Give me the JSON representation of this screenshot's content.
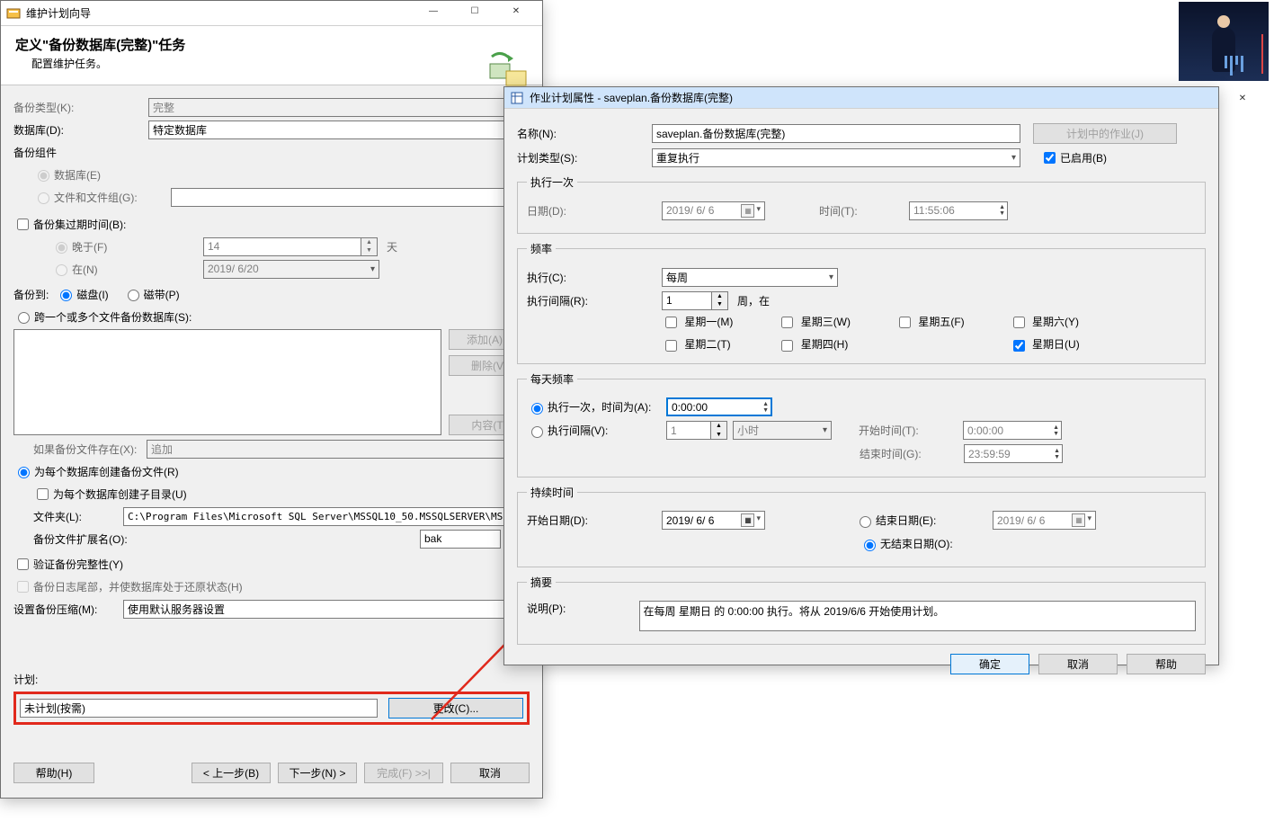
{
  "wizard": {
    "title": "维护计划向导",
    "header_title": "定义\"备份数据库(完整)\"任务",
    "header_sub": "配置维护任务。",
    "backup_type_label": "备份类型(K):",
    "backup_type_value": "完整",
    "database_label": "数据库(D):",
    "database_value": "特定数据库",
    "components_label": "备份组件",
    "comp_database": "数据库(E)",
    "comp_files": "文件和文件组(G):",
    "set_expire_label": "备份集过期时间(B):",
    "expire_after_label": "晚于(F)",
    "expire_after_value": "14",
    "expire_after_unit": "天",
    "expire_on_label": "在(N)",
    "expire_on_value": "2019/ 6/20",
    "backup_to_label": "备份到:",
    "to_disk": "磁盘(I)",
    "to_tape": "磁带(P)",
    "across_files": "跨一个或多个文件备份数据库(S):",
    "add_btn": "添加(A)...",
    "remove_btn": "删除(V)",
    "contents_btn": "内容(T)",
    "if_exists_label": "如果备份文件存在(X):",
    "if_exists_value": "追加",
    "per_db_label": "为每个数据库创建备份文件(R)",
    "per_db_subdir": "为每个数据库创建子目录(U)",
    "folder_label": "文件夹(L):",
    "folder_value": "C:\\Program Files\\Microsoft SQL Server\\MSSQL10_50.MSSQLSERVER\\MSSQL\\Bac.",
    "ext_label": "备份文件扩展名(O):",
    "ext_value": "bak",
    "verify_label": "验证备份完整性(Y)",
    "tail_log_label": "备份日志尾部，并使数据库处于还原状态(H)",
    "compression_label": "设置备份压缩(M):",
    "compression_value": "使用默认服务器设置",
    "schedule_section": "计划:",
    "schedule_value": "未计划(按需)",
    "change_btn": "更改(C)...",
    "help_btn": "帮助(H)",
    "back_btn": "< 上一步(B)",
    "next_btn": "下一步(N) >",
    "finish_btn": "完成(F) >>|",
    "cancel_btn": "取消"
  },
  "sched": {
    "title": "作业计划属性 - saveplan.备份数据库(完整)",
    "name_label": "名称(N):",
    "name_value": "saveplan.备份数据库(完整)",
    "jobs_btn": "计划中的作业(J)",
    "type_label": "计划类型(S):",
    "type_value": "重复执行",
    "enabled_label": "已启用(B)",
    "once_group": "执行一次",
    "once_date_label": "日期(D):",
    "once_date_value": "2019/ 6/ 6",
    "once_time_label": "时间(T):",
    "once_time_value": "11:55:06",
    "freq_group": "频率",
    "freq_exec_label": "执行(C):",
    "freq_exec_value": "每周",
    "freq_int_label": "执行间隔(R):",
    "freq_int_value": "1",
    "freq_int_unit": "周，在",
    "wk_mon": "星期一(M)",
    "wk_tue": "星期二(T)",
    "wk_wed": "星期三(W)",
    "wk_thu": "星期四(H)",
    "wk_fri": "星期五(F)",
    "wk_sat": "星期六(Y)",
    "wk_sun": "星期日(U)",
    "daily_group": "每天频率",
    "daily_once_label": "执行一次，时间为(A):",
    "daily_once_value": "0:00:00",
    "daily_int_label": "执行间隔(V):",
    "daily_int_value": "1",
    "daily_int_unit": "小时",
    "daily_start_label": "开始时间(T):",
    "daily_start_value": "0:00:00",
    "daily_end_label": "结束时间(G):",
    "daily_end_value": "23:59:59",
    "dur_group": "持续时间",
    "dur_start_label": "开始日期(D):",
    "dur_start_value": "2019/ 6/ 6",
    "dur_end_label": "结束日期(E):",
    "dur_end_value": "2019/ 6/ 6",
    "dur_noend_label": "无结束日期(O):",
    "summary_group": "摘要",
    "summary_label": "说明(P):",
    "summary_value": "在每周 星期日 的 0:00:00 执行。将从 2019/6/6 开始使用计划。",
    "ok_btn": "确定",
    "cancel_btn": "取消",
    "help_btn": "帮助"
  },
  "glyph": {
    "min": "—",
    "max": "☐",
    "close": "✕",
    "dd": "▾",
    "up": "▲",
    "dn": "▼"
  }
}
